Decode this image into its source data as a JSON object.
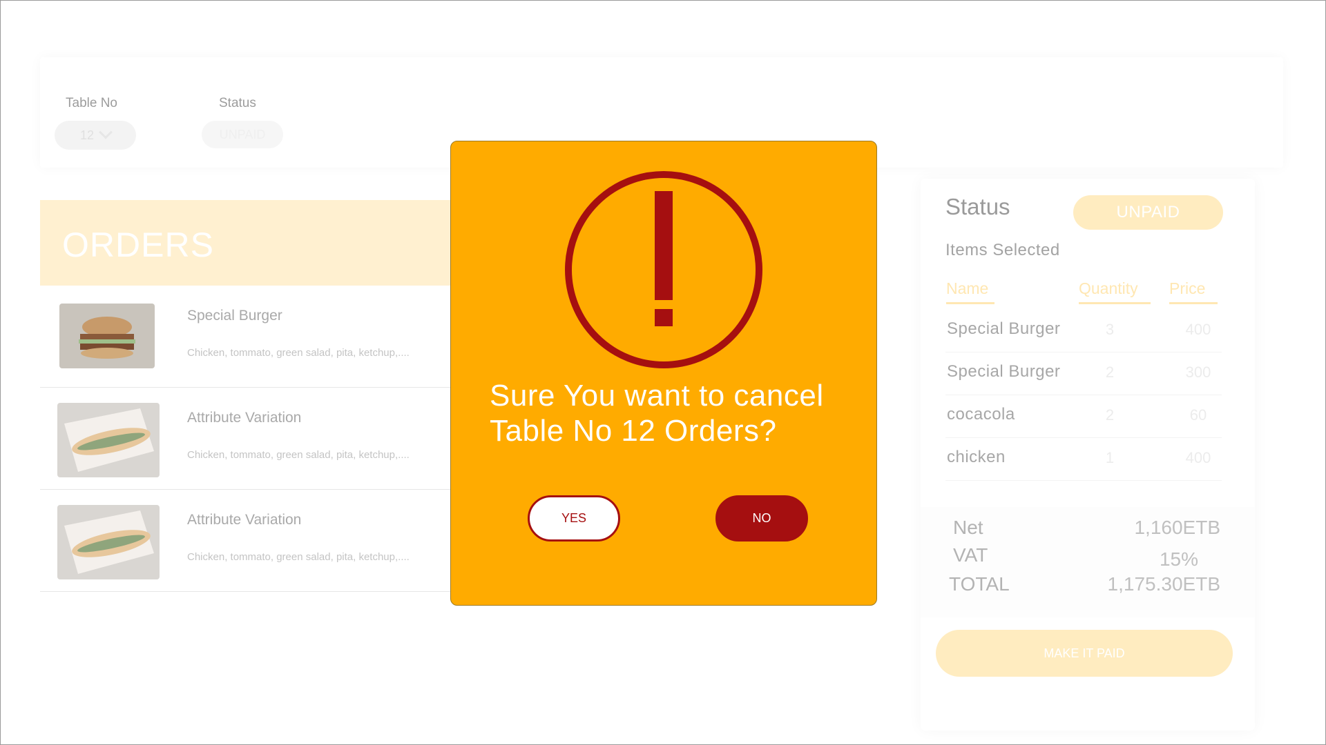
{
  "filters": {
    "table_label": "Table No",
    "table_value": "12",
    "status_label": "Status",
    "status_value": "UNPAID"
  },
  "orders": {
    "title": "ORDERS",
    "items": [
      {
        "name": "Special Burger",
        "description": "Chicken, tommato, green salad, pita, ketchup,....",
        "image": "burger-photo"
      },
      {
        "name": "Attribute Variation",
        "description": "Chicken, tommato, green salad, pita, ketchup,....",
        "image": "sandwich-photo"
      },
      {
        "name": "Attribute Variation",
        "description": "Chicken, tommato, green salad, pita, ketchup,....",
        "image": "sandwich-photo"
      }
    ]
  },
  "summary": {
    "status_label": "Status",
    "status_value": "UNPAID",
    "items_selected_label": "Items Selected",
    "columns": {
      "name": "Name",
      "quantity": "Quantity",
      "price": "Price"
    },
    "rows": [
      {
        "name": "Special Burger",
        "quantity": "3",
        "price": "400"
      },
      {
        "name": "Special Burger",
        "quantity": "2",
        "price": "300"
      },
      {
        "name": "cocacola",
        "quantity": "2",
        "price": "60"
      },
      {
        "name": "chicken",
        "quantity": "1",
        "price": "400"
      }
    ],
    "totals": {
      "net_label": "Net",
      "net_value": "1,160ETB",
      "vat_label": "VAT",
      "vat_value": "15%",
      "total_label": "TOTAL",
      "total_value": "1,175.30ETB"
    },
    "pay_button": "MAKE IT PAID"
  },
  "modal": {
    "icon": "exclamation-circle-icon",
    "message": "Sure You want to cancel Table No 12 Orders?",
    "yes_label": "YES",
    "no_label": "NO"
  },
  "colors": {
    "modal_bg": "#ffab00",
    "accent_red": "#a50f10",
    "faded_accent": "#ffecc0"
  }
}
